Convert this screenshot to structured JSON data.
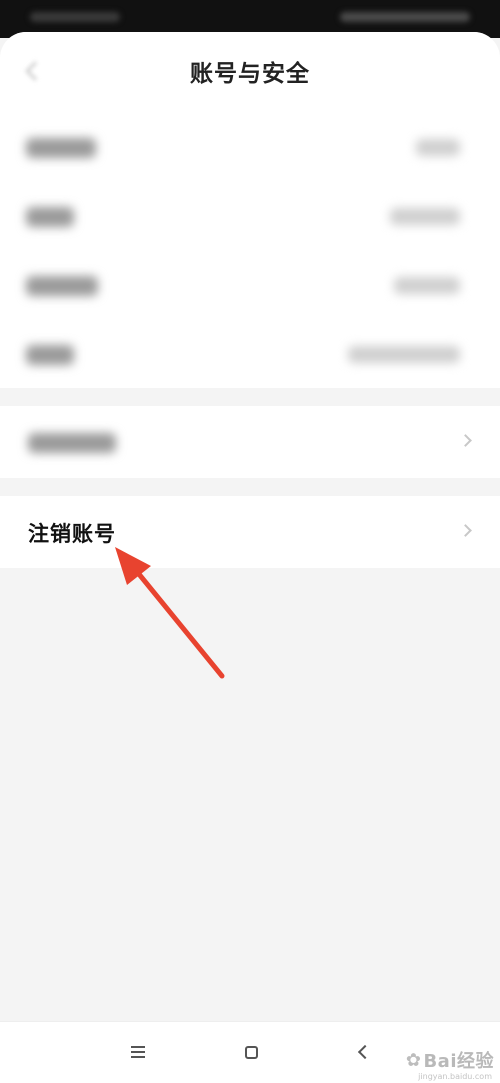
{
  "header": {
    "title": "账号与安全"
  },
  "settings": {
    "blurred_rows": [
      {
        "label_width": 70,
        "value_width": 44
      },
      {
        "label_width": 48,
        "value_width": 70
      },
      {
        "label_width": 72,
        "value_width": 66
      },
      {
        "label_width": 48,
        "value_width": 112
      }
    ],
    "blurred_nav_label_width": 88,
    "delete_account_label": "注销账号"
  },
  "annotation": {
    "arrow_color": "#e8432f"
  },
  "navigation_bar": {
    "menu_icon": "menu-icon",
    "home_icon": "home-icon",
    "back_icon": "back-icon"
  },
  "watermark": {
    "text": "Bai经验",
    "subtext": "jingyan.baidu.com"
  }
}
